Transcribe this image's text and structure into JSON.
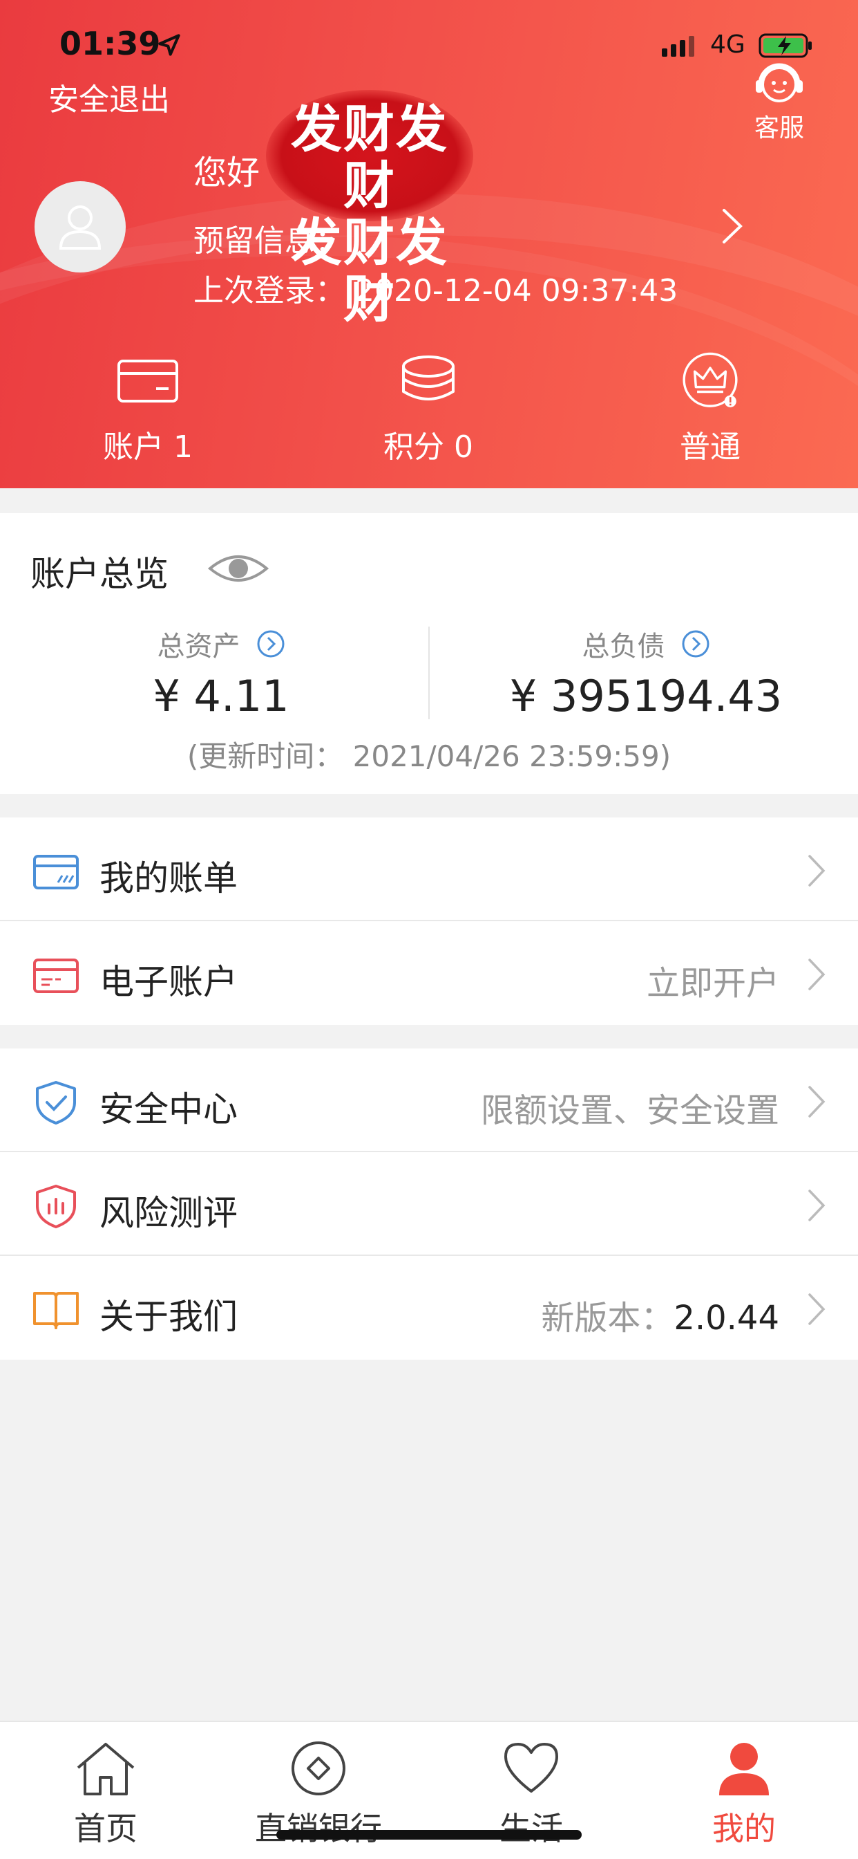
{
  "status_bar": {
    "time": "01:39",
    "network": "4G"
  },
  "header": {
    "logout_label": "安全退出",
    "service_label": "客服",
    "greeting": "您好",
    "stamp_line1": "发财发财",
    "stamp_line2": "发财发财",
    "reserved_info": "预留信息：",
    "last_login": "上次登录：  2020-12-04 09:37:43",
    "stats": [
      {
        "label": "账户    1",
        "icon": "card-icon"
      },
      {
        "label": "积分 0",
        "icon": "coins-icon"
      },
      {
        "label": "普通",
        "icon": "crown-icon"
      }
    ]
  },
  "overview": {
    "title": "账户总览",
    "total_assets_label": "总资产",
    "total_assets_value": "¥ 4.11",
    "total_liabilities_label": "总负债",
    "total_liabilities_value": "¥ 395194.43",
    "updated": "(更新时间：  2021/04/26 23:59:59)"
  },
  "menu_group1": [
    {
      "label": "我的账单",
      "value": "",
      "icon": "bill-card-icon"
    },
    {
      "label": "电子账户",
      "value": "立即开户",
      "icon": "e-account-icon"
    }
  ],
  "menu_group2": [
    {
      "label": "安全中心",
      "value": "限额设置、安全设置",
      "icon": "shield-check-icon"
    },
    {
      "label": "风险测评",
      "value": "",
      "icon": "shield-chart-icon"
    },
    {
      "label": "关于我们",
      "value_prefix": "新版本：",
      "value": "2.0.44",
      "icon": "book-icon"
    }
  ],
  "tabbar": [
    {
      "label": "首页",
      "icon": "home-icon"
    },
    {
      "label": "直销银行",
      "icon": "diamond-circle-icon"
    },
    {
      "label": "生活",
      "icon": "heart-icon"
    },
    {
      "label": "我的",
      "icon": "person-icon",
      "active": true
    }
  ],
  "colors": {
    "brand_red": "#f04a3e",
    "blue_icon": "#4a8fd8",
    "orange_icon": "#f0922e"
  }
}
